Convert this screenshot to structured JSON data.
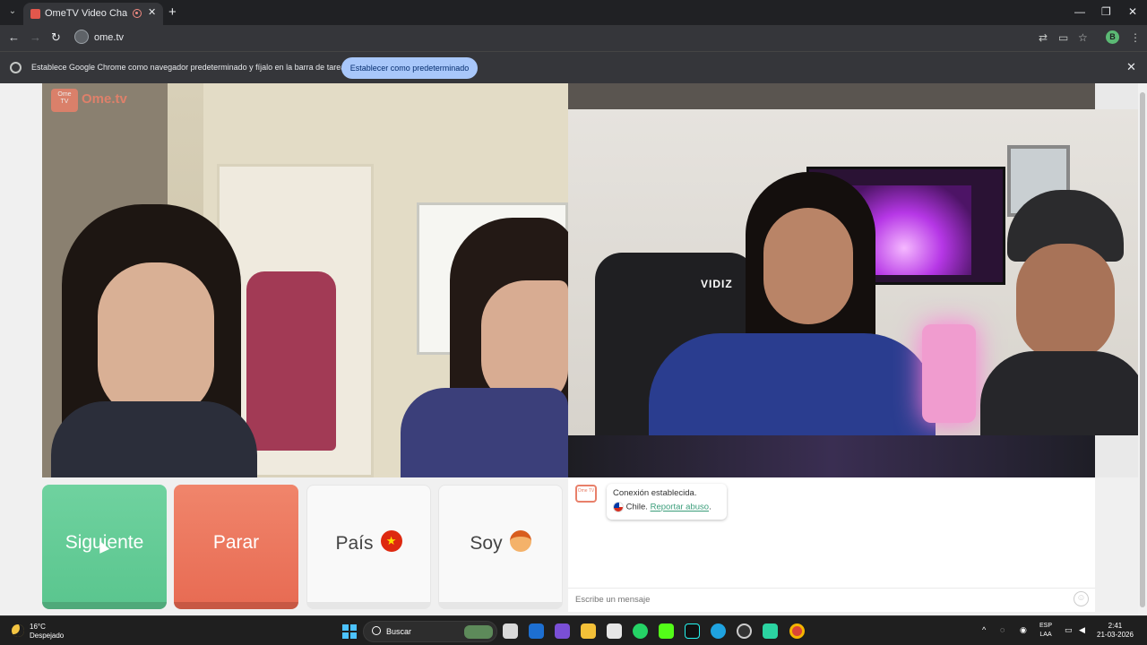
{
  "browser": {
    "tab_title": "OmeTV Video Chat — Ome",
    "tab_close": "✕",
    "new_tab": "+",
    "url": "ome.tv",
    "profile_initial": "B",
    "window_min": "—",
    "window_max": "❐",
    "window_close": "✕"
  },
  "infobar": {
    "message": "Establece Google Chrome como navegador predeterminado y fíjalo en la barra de tareas",
    "button": "Establecer como predeterminado",
    "close": "✕"
  },
  "video": {
    "logo_box": "Ome TV",
    "logo_text": "Ome.tv",
    "remote_shirt_text": "VIDIZ"
  },
  "controls": {
    "next": "Siguiente",
    "stop": "Parar",
    "country": "País",
    "gender": "Soy"
  },
  "chat": {
    "logo": "Ome TV",
    "connection": "Conexión establecida.",
    "country": "Chile.",
    "report": "Reportar abuso",
    "report_suffix": ".",
    "input_placeholder": "Escribe un mensaje"
  },
  "taskbar": {
    "temperature": "16°C",
    "weather": "Despejado",
    "search": "Buscar",
    "language": "ESP",
    "layout": "LAA",
    "time": "2:41",
    "date": "21-03-2026"
  },
  "colors": {
    "next_button": "#5bc68f",
    "stop_button": "#e86c54",
    "accent_link": "#3a9d7a",
    "brand": "#e8806a"
  }
}
